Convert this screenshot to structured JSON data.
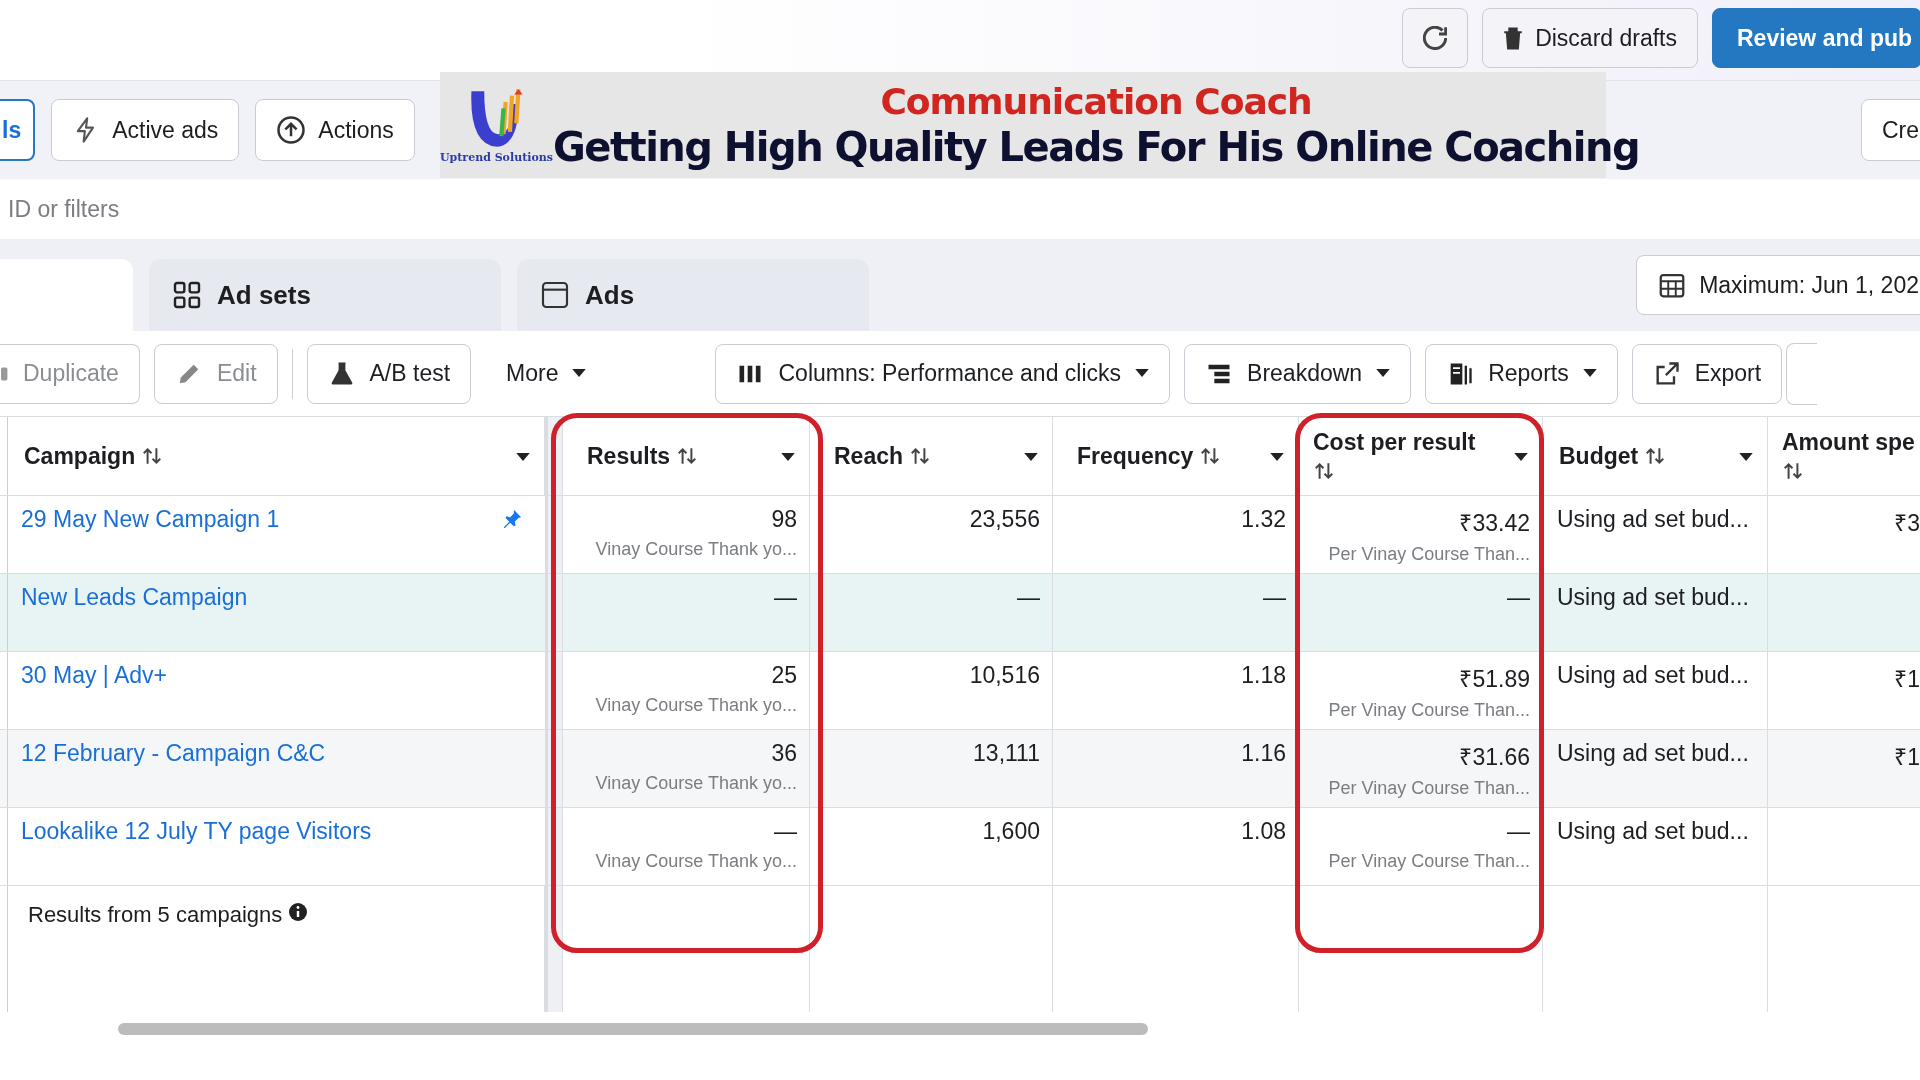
{
  "top_bar": {
    "buttons": [
      {
        "kind": "refresh"
      },
      {
        "kind": "discard",
        "label": "Discard drafts"
      },
      {
        "kind": "primary",
        "label": "Review and pub"
      }
    ]
  },
  "action_bar": {
    "buttons": [
      {
        "kind": "selected",
        "label": "ls"
      },
      {
        "kind": "active-ads",
        "label": "Active ads"
      },
      {
        "kind": "actions",
        "label": "Actions"
      }
    ],
    "right_button": "Cre"
  },
  "filter": {
    "placeholder": "ID or filters"
  },
  "tabs": [
    {
      "kind": "campaigns",
      "selected": true
    },
    {
      "kind": "adsets",
      "label": "Ad sets",
      "selected": false
    },
    {
      "kind": "ads",
      "label": "Ads",
      "selected": false
    }
  ],
  "date_range": "Maximum: Jun 1, 202",
  "toolbar": [
    {
      "kind": "duplicate",
      "label": "Duplicate",
      "disabled": true
    },
    {
      "kind": "edit",
      "label": "Edit",
      "disabled": true
    },
    {
      "kind": "abtest",
      "label": "A/B test",
      "disabled": false
    },
    {
      "kind": "more",
      "label": "More",
      "disabled": false
    },
    {
      "kind": "columns",
      "label": "Columns: Performance and clicks",
      "disabled": false
    },
    {
      "kind": "breakdown",
      "label": "Breakdown",
      "disabled": false
    },
    {
      "kind": "reports",
      "label": "Reports",
      "disabled": false
    },
    {
      "kind": "export",
      "label": "Export",
      "disabled": false
    }
  ],
  "table": {
    "columns": [
      {
        "label": "Campaign",
        "highlighted": false
      },
      {
        "label": "Results",
        "highlighted": true
      },
      {
        "label": "Reach",
        "highlighted": false
      },
      {
        "label": "Frequency",
        "highlighted": false
      },
      {
        "label": "Cost per result",
        "highlighted": true
      },
      {
        "label": "Budget",
        "highlighted": false
      },
      {
        "label": "Amount spe",
        "highlighted": false
      }
    ],
    "rows": [
      {
        "campaign": "29 May New Campaign 1",
        "pinned": true,
        "selected": false,
        "results": "98",
        "results_note": "Vinay Course Thank yo...",
        "reach": "23,556",
        "frequency": "1.32",
        "cost": "₹33.42",
        "cost_note": "Per Vinay Course Than...",
        "budget": "Using ad set bud...",
        "amount": "₹3"
      },
      {
        "campaign": "New Leads Campaign",
        "pinned": false,
        "selected": true,
        "results": "—",
        "reach": "—",
        "frequency": "—",
        "cost": "—",
        "budget": "Using ad set bud..."
      },
      {
        "campaign": "30 May | Adv+",
        "pinned": false,
        "selected": false,
        "results": "25",
        "results_note": "Vinay Course Thank yo...",
        "reach": "10,516",
        "frequency": "1.18",
        "cost": "₹51.89",
        "cost_note": "Per Vinay Course Than...",
        "budget": "Using ad set bud...",
        "amount": "₹1"
      },
      {
        "campaign": "12 February - Campaign C&C",
        "pinned": false,
        "selected": false,
        "results": "36",
        "results_note": "Vinay Course Thank yo...",
        "reach": "13,111",
        "frequency": "1.16",
        "cost": "₹31.66",
        "cost_note": "Per Vinay Course Than...",
        "budget": "Using ad set bud...",
        "amount": "₹1"
      },
      {
        "campaign": "Lookalike 12 July TY page Visitors",
        "pinned": false,
        "selected": false,
        "results": "—",
        "results_note": "Vinay Course Thank yo...",
        "reach": "1,600",
        "frequency": "1.08",
        "cost": "—",
        "cost_note": "Per Vinay Course Than...",
        "budget": "Using ad set bud..."
      }
    ],
    "footer": "Results from 5 campaigns"
  },
  "banner": {
    "brand": "Uptrend Solutions",
    "title": "Communication Coach",
    "subtitle": "Getting High Quality Leads For His Online Coaching"
  }
}
